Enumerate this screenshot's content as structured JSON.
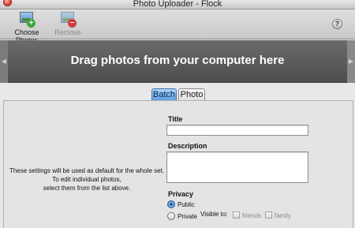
{
  "window": {
    "title": "Photo Uploader - Flock"
  },
  "toolbar": {
    "choose_label": "Choose Photos",
    "remove_label": "Remove",
    "help_symbol": "?"
  },
  "dropzone": {
    "message": "Drag photos from your computer here"
  },
  "tabs": [
    {
      "label": "Batch",
      "selected": true
    },
    {
      "label": "Photo",
      "selected": false
    }
  ],
  "batch": {
    "hint_lines": [
      "These settings will be used as default for the whole set.",
      "To edit individual photos,",
      "select them from the list above."
    ],
    "title_label": "Title",
    "title_value": "",
    "description_label": "Description",
    "description_value": "",
    "privacy_label": "Privacy",
    "public_label": "Public",
    "private_label": "Private",
    "privacy_selected": "Public",
    "visible_to_label": "Visible to:",
    "friends_label": "friends",
    "family_label": "family"
  }
}
